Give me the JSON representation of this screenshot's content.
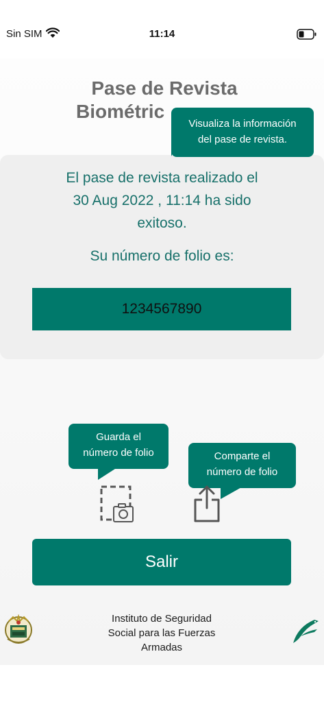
{
  "status_bar": {
    "carrier": "Sin SIM",
    "time": "11:14",
    "wifi_icon": "wifi-icon",
    "battery_icon": "battery-icon"
  },
  "header": {
    "title_line1": "Pase de Revista",
    "title_line2": "Biométric"
  },
  "tooltips": {
    "info": {
      "line1": "Visualiza la información",
      "line2": "del pase de revista."
    },
    "save": {
      "line1": "Guarda el",
      "line2": "número de folio"
    },
    "share": {
      "line1": "Comparte el",
      "line2": "número de folio"
    }
  },
  "result": {
    "line1": "El pase de revista realizado el",
    "line2": "30 Aug 2022 , 11:14 ha sido",
    "line3": "exitoso.",
    "folio_label": "Su número de folio es:",
    "folio_number": "1234567890"
  },
  "actions": {
    "save_icon": "save-screenshot-icon",
    "share_icon": "share-icon",
    "exit_label": "Salir"
  },
  "footer": {
    "line1": "Instituto de Seguridad",
    "line2": "Social para las Fuerzas",
    "line3": "Armadas",
    "seal_icon": "institute-seal-icon",
    "logo_icon": "eagle-logo-icon"
  },
  "colors": {
    "primary": "#00796b",
    "text_accent": "#17706a",
    "title": "#6b6b6b",
    "card": "#efefef"
  }
}
